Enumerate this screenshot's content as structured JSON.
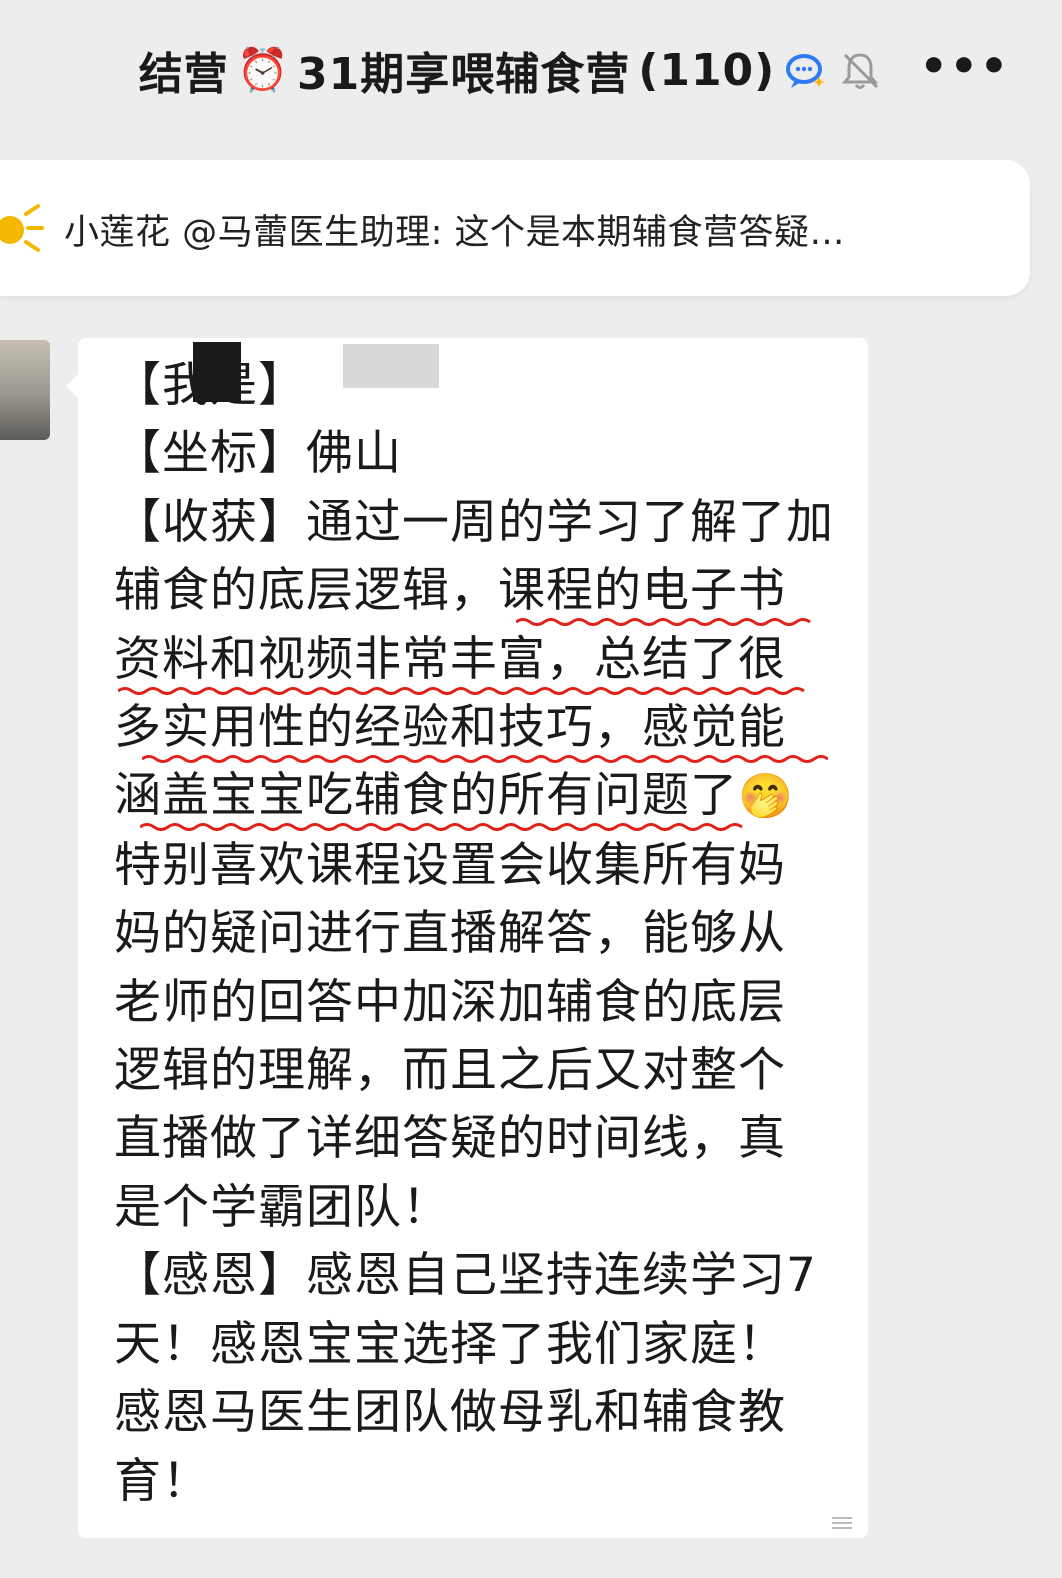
{
  "header": {
    "title_prefix": "结营",
    "clock_emoji": "⏰",
    "title_main": "31期享喂辅食营",
    "member_count": "(110)",
    "more_label": "•••",
    "chat_icon": "ai-chat-icon",
    "mute_icon": "bell-muted-icon"
  },
  "pinned": {
    "text": "小莲花 @马蕾医生助理: 这个是本期辅食营答疑…",
    "icon": "megaphone-icon"
  },
  "message": {
    "lines": [
      "【我是】",
      "【坐标】佛山",
      "【收获】通过一周的学习了解了加",
      "辅食的底层逻辑，课程的电子书",
      "资料和视频非常丰富，总结了很",
      "多实用性的经验和技巧，感觉能",
      "涵盖宝宝吃辅食的所有问题了",
      "特别喜欢课程设置会收集所有妈",
      "妈的疑问进行直播解答，能够从",
      "老师的回答中加深加辅食的底层",
      "逻辑的理解，而且之后又对整个",
      "直播做了详细答疑的时间线，真",
      "是个学霸团队！",
      "【感恩】感恩自己坚持连续学习7",
      "天！感恩宝宝选择了我们家庭！",
      "感恩马医生团队做母乳和辅食教",
      "育！"
    ],
    "emoji": "🤭"
  },
  "colors": {
    "background": "#ededed",
    "bubble": "#ffffff",
    "underline": "#e0231c",
    "notice_icon": "#f5b800"
  }
}
